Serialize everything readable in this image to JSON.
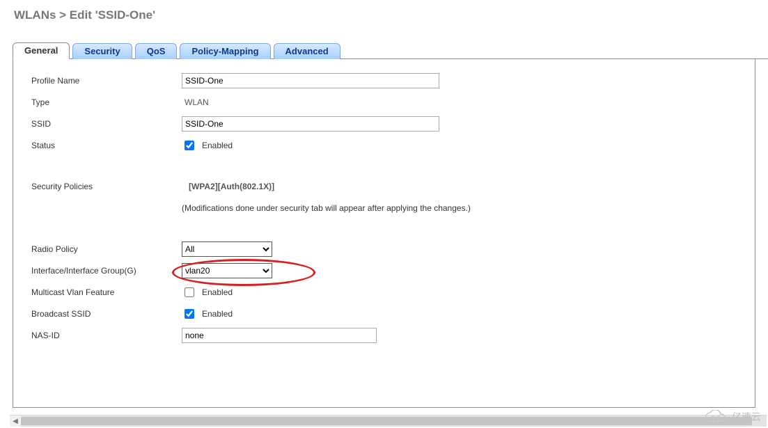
{
  "breadcrumb": "WLANs > Edit   'SSID-One'",
  "tabs": {
    "general": "General",
    "security": "Security",
    "qos": "QoS",
    "policy": "Policy-Mapping",
    "advanced": "Advanced"
  },
  "form": {
    "profile_name_label": "Profile Name",
    "profile_name_value": "SSID-One",
    "type_label": "Type",
    "type_value": "WLAN",
    "ssid_label": "SSID",
    "ssid_value": "SSID-One",
    "status_label": "Status",
    "status_checked": true,
    "status_enabled_text": "Enabled",
    "sec_pol_label": "Security Policies",
    "sec_pol_value": "[WPA2][Auth(802.1X)]",
    "sec_pol_note": "(Modifications done under security tab will appear after applying the changes.)",
    "radio_policy_label": "Radio Policy",
    "radio_policy_value": "All",
    "iface_label": "Interface/Interface Group(G)",
    "iface_value": "vlan20",
    "mcast_label": "Multicast Vlan Feature",
    "mcast_checked": false,
    "mcast_enabled_text": "Enabled",
    "bcast_label": "Broadcast SSID",
    "bcast_checked": true,
    "bcast_enabled_text": "Enabled",
    "nasid_label": "NAS-ID",
    "nasid_value": "none"
  },
  "watermark": "亿速云"
}
